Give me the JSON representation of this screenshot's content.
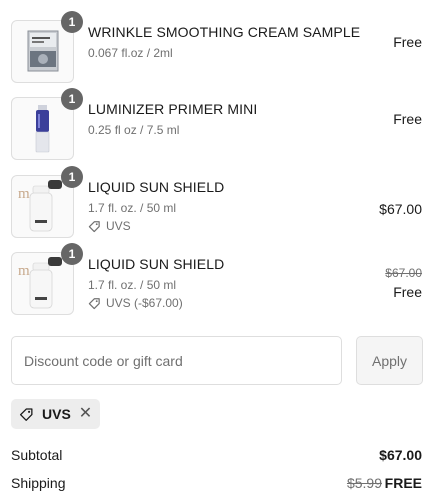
{
  "line_items": [
    {
      "quantity": "1",
      "name": "WRINKLE SMOOTHING CREAM SAMPLE",
      "variant": "0.067 fl.oz / 2ml",
      "price": "Free",
      "image_icon": "sample-sachet-image"
    },
    {
      "quantity": "1",
      "name": "LUMINIZER PRIMER MINI",
      "variant": "0.25 fl oz / 7.5 ml",
      "price": "Free",
      "image_icon": "primer-tube-image"
    },
    {
      "quantity": "1",
      "name": "LIQUID SUN SHIELD",
      "variant": "1.7 fl. oz. / 50 ml",
      "discount": "UVS",
      "price": "$67.00",
      "image_icon": "sunscreen-bottle-image"
    },
    {
      "quantity": "1",
      "name": "LIQUID SUN SHIELD",
      "variant": "1.7 fl. oz. / 50 ml",
      "discount": "UVS (-$67.00)",
      "original_price": "$67.00",
      "price": "Free",
      "image_icon": "sunscreen-bottle-image"
    }
  ],
  "discount_form": {
    "placeholder": "Discount code or gift card",
    "value": "",
    "apply_label": "Apply"
  },
  "applied_code": {
    "label": "UVS",
    "icon": "tag-icon",
    "remove_icon": "close-icon"
  },
  "summary": {
    "subtotal_label": "Subtotal",
    "subtotal_value": "$67.00",
    "shipping_label": "Shipping",
    "shipping_original": "$5.99",
    "shipping_value": "FREE"
  },
  "colors": {
    "badge": "#666666",
    "muted_text": "#707070",
    "border": "#dedede",
    "chip_bg": "#ededed"
  }
}
